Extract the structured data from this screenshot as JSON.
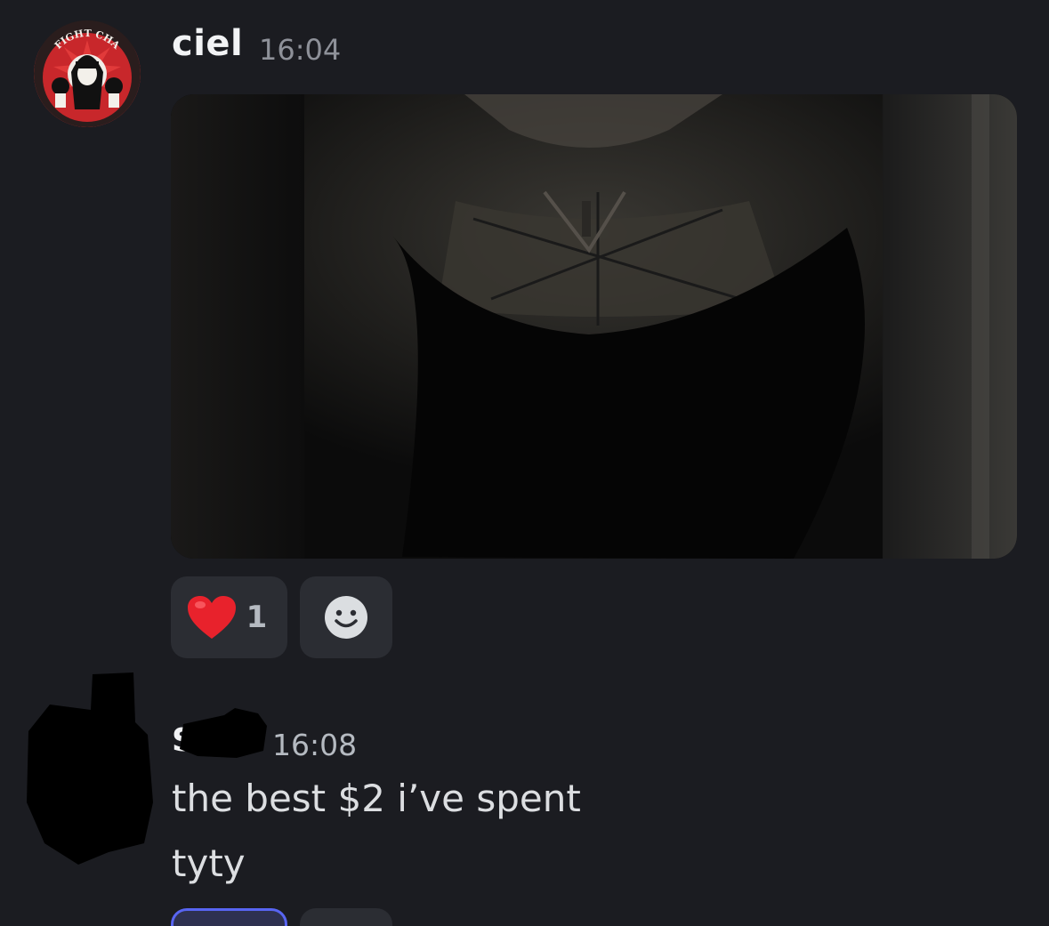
{
  "messages": [
    {
      "author": "ciel",
      "timestamp": "16:04",
      "avatar_text": "FIGHT CHA",
      "attachment_icon": "image-photo-icon",
      "reactions": [
        {
          "emoji_icon": "red-heart-emoji-icon",
          "count": "1"
        },
        {
          "emoji_icon": "add-reaction-smiley-icon",
          "count": ""
        }
      ]
    },
    {
      "author": "S",
      "author_redacted": true,
      "avatar_redacted": true,
      "timestamp": "16:08",
      "lines": [
        "the best $2 i’ve spent",
        "tyty"
      ]
    }
  ],
  "colors": {
    "background": "#1b1c21",
    "reaction_bg": "#2b2d33",
    "reaction_active_border": "#5865f2",
    "timestamp": "#8e9199"
  }
}
